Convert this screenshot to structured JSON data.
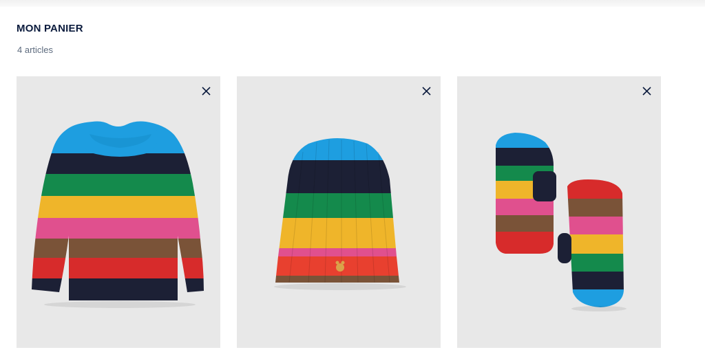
{
  "header": {
    "title": "MON PANIER",
    "item_count": "4 articles"
  },
  "cart": {
    "items": [
      {
        "name": "sweater",
        "icon": "remove-icon"
      },
      {
        "name": "beanie",
        "icon": "remove-icon"
      },
      {
        "name": "mittens",
        "icon": "remove-icon"
      }
    ]
  },
  "colors": {
    "title": "#0b1b3d",
    "muted_text": "#5d6b7e",
    "card_background": "#e8e8e8",
    "stripe_blue": "#1e9ee0",
    "stripe_navy": "#1c2035",
    "stripe_green": "#148a4c",
    "stripe_yellow": "#efb52a",
    "stripe_pink": "#e0508e",
    "stripe_brown": "#7a5338",
    "stripe_red": "#d72b2b"
  }
}
